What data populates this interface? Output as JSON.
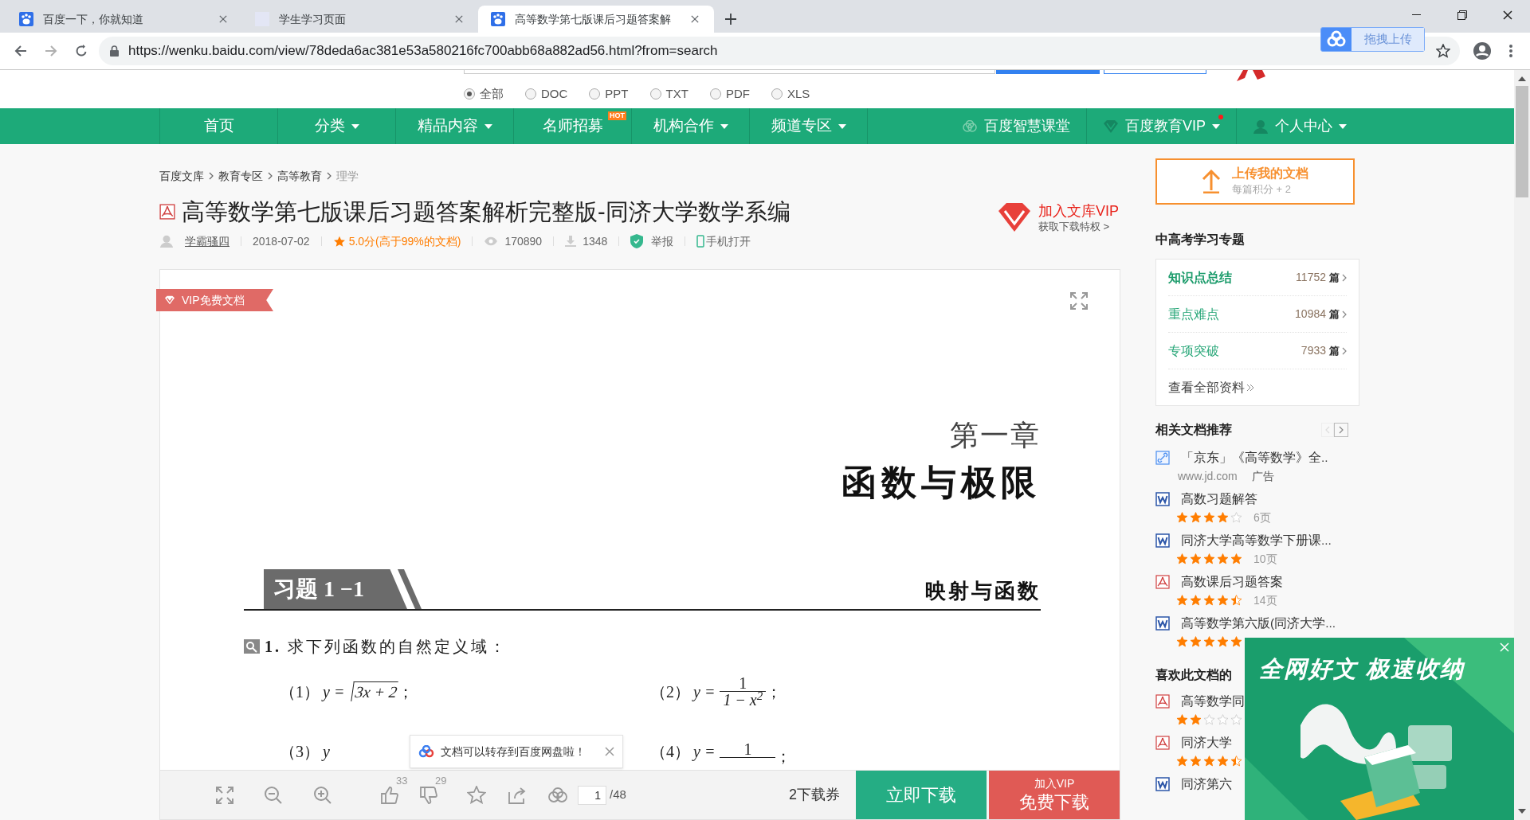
{
  "browser": {
    "tabs": [
      {
        "title": "百度一下，你就知道",
        "selected": false
      },
      {
        "title": "学生学习页面",
        "selected": false
      },
      {
        "title": "高等数学第七版课后习题答案解",
        "selected": true
      }
    ],
    "url": "https://wenku.baidu.com/view/78deda6ac381e53a580216fc700abb68a882ad56.html?from=search",
    "extension_button": "拖拽上传"
  },
  "filters": [
    {
      "label": "全部",
      "selected": true
    },
    {
      "label": "DOC",
      "selected": false
    },
    {
      "label": "PPT",
      "selected": false
    },
    {
      "label": "TXT",
      "selected": false
    },
    {
      "label": "PDF",
      "selected": false
    },
    {
      "label": "XLS",
      "selected": false
    }
  ],
  "nav": [
    {
      "label": "首页",
      "dropdown": false
    },
    {
      "label": "分类",
      "dropdown": true
    },
    {
      "label": "精品内容",
      "dropdown": true
    },
    {
      "label": "名师招募",
      "dropdown": false,
      "badge": "HOT"
    },
    {
      "label": "机构合作",
      "dropdown": true
    },
    {
      "label": "频道专区",
      "dropdown": true
    }
  ],
  "nav_right": [
    {
      "label": "百度智慧课堂",
      "dropdown": false,
      "notify": false
    },
    {
      "label": "百度教育VIP",
      "dropdown": true,
      "notify": true
    },
    {
      "label": "个人中心",
      "dropdown": true,
      "notify": false
    }
  ],
  "breadcrumb": [
    {
      "label": "百度文库",
      "current": false
    },
    {
      "label": "教育专区",
      "current": false
    },
    {
      "label": "高等教育",
      "current": false
    },
    {
      "label": "理学",
      "current": true
    }
  ],
  "document": {
    "title": "高等数学第七版课后习题答案解析完整版-同济大学数学系编",
    "author": "学霸骚四",
    "date": "2018-07-02",
    "rating": "5.0分(高于99%的文档)",
    "views": "170890",
    "downloads": "1348",
    "report": "举报",
    "mobile": "手机打开",
    "vip_promo": {
      "title": "加入文库VIP",
      "subtitle": "获取下载特权 >"
    },
    "badge": "VIP免费文档",
    "page": {
      "chapter": "第一章",
      "chapter_title": "函数与极限",
      "section_label": "习题 1 −1",
      "section_title": "映射与函数",
      "question": "**1.** 求下列函数的自然定义域：",
      "formula_rows": [
        [
          {
            "kind": "sqrt",
            "number": "（1）",
            "lhs": "y =",
            "radicand": "3x + 2",
            "tail": "；"
          },
          {
            "kind": "fraction",
            "number": "（2）",
            "lhs": "y =",
            "numerator": "1",
            "denominator": "1 − x$^{2}$",
            "tail": "；"
          }
        ],
        [
          {
            "kind": "plain",
            "number": "（3）",
            "lhs": "y"
          },
          {
            "kind": "fraction_top",
            "number": "（4）",
            "lhs": "y =",
            "numerator": "1",
            "tail": "；"
          }
        ]
      ]
    },
    "toast": "文档可以转存到百度网盘啦！",
    "toolbar": {
      "likes": "33",
      "dislikes": "29",
      "page": "1",
      "total": "/48",
      "coupons": "2下载券",
      "download": "立即下载",
      "vip_top": "加入VIP",
      "vip_bottom": "免费下载"
    }
  },
  "sidebar": {
    "upload": {
      "title": "上传我的文档",
      "subtitle": "每篇积分 + 2"
    },
    "topics_heading": "中高考学习专题",
    "topics": [
      {
        "label": "知识点总结",
        "count": "11752",
        "unit": "篇",
        "selected": true
      },
      {
        "label": "重点难点",
        "count": "10984",
        "unit": "篇",
        "selected": false
      },
      {
        "label": "专项突破",
        "count": "7933",
        "unit": "篇",
        "selected": false
      }
    ],
    "topics_more": "查看全部资料",
    "related_heading": "相关文档推荐",
    "related": [
      {
        "kind": "link",
        "title": "「京东」《高等数学》全..",
        "source": "www.jd.com",
        "ad_label": "广告"
      },
      {
        "kind": "word",
        "title": "高数习题解答",
        "stars": 4,
        "pages": "6页"
      },
      {
        "kind": "word",
        "title": "同济大学高等数学下册课...",
        "stars": 5,
        "pages": "10页"
      },
      {
        "kind": "pdf",
        "title": "高数课后习题答案",
        "stars": 4.5,
        "pages": "14页"
      },
      {
        "kind": "word",
        "title": "高等数学第六版(同济大学...",
        "stars": 5
      }
    ],
    "liked_heading": "喜欢此文档的",
    "liked": [
      {
        "kind": "pdf",
        "title": "高等数学同",
        "stars": 2
      },
      {
        "kind": "pdf",
        "title": "同济大学",
        "stars": 4.5
      },
      {
        "kind": "word",
        "title": "同济第六"
      }
    ]
  },
  "ad": {
    "title": "全网好文 极速收纳"
  }
}
